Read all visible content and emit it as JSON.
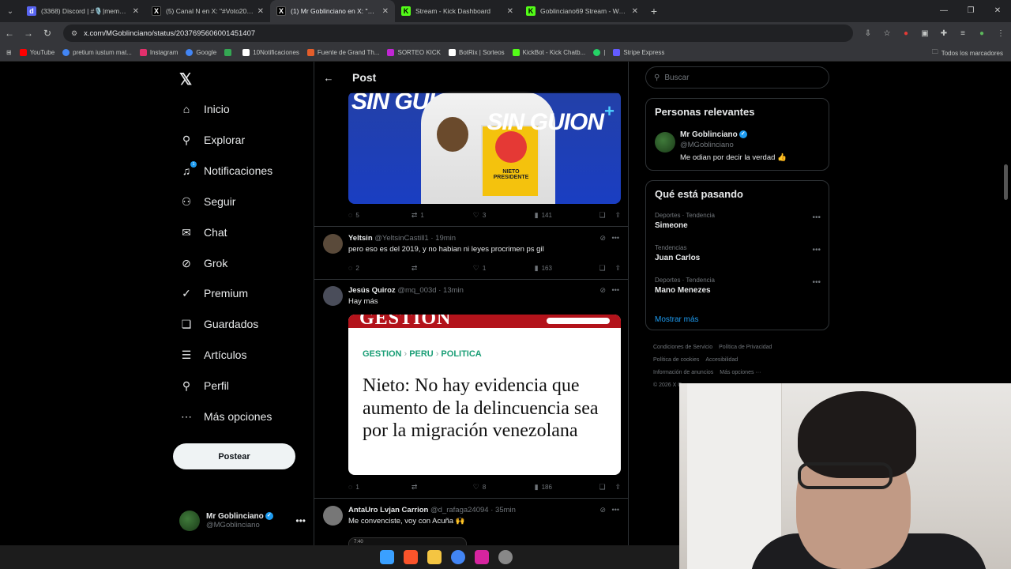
{
  "browser": {
    "tabs": [
      {
        "title": "(3368) Discord | #🎙️|memes |",
        "favicon_color": "#5865f2",
        "active": false
      },
      {
        "title": "(5) Canal N en X: \"#Voto2026 E",
        "favicon_color": "#000000",
        "active": false
      },
      {
        "title": "(1) Mr Goblinciano en X: \"Me o",
        "favicon_color": "#000000",
        "active": true
      },
      {
        "title": "Stream - Kick Dashboard",
        "favicon_color": "#53fc18",
        "active": false
      },
      {
        "title": "Goblinciano69 Stream - Watch",
        "favicon_color": "#53fc18",
        "active": false
      }
    ],
    "url": "x.com/MGoblinciano/status/2037695606001451407",
    "bookmarks": [
      {
        "label": "YouTube",
        "color": "#ff0000"
      },
      {
        "label": "pretium iustum mat...",
        "color": "#4285f4"
      },
      {
        "label": "Instagram",
        "color": "#e1306c"
      },
      {
        "label": "Google",
        "color": "#4285f4"
      },
      {
        "label": "",
        "color": "#34a853"
      },
      {
        "label": "10Notificaciones",
        "color": "#000000"
      },
      {
        "label": "Fuente de Grand Th...",
        "color": "#e35d2a"
      },
      {
        "label": "SORTEO KICK",
        "color": "#c026d3"
      },
      {
        "label": "BotRix | Sorteos",
        "color": "#ffffff"
      },
      {
        "label": "KickBot - Kick Chatb...",
        "color": "#53fc18"
      },
      {
        "label": "|",
        "color": "#25d366"
      },
      {
        "label": "Stripe Express",
        "color": "#635bff"
      }
    ],
    "all_bookmarks": "Todos los marcadores"
  },
  "nav": {
    "items": [
      {
        "label": "Inicio",
        "icon": "home-icon",
        "glyph": "⌂"
      },
      {
        "label": "Explorar",
        "icon": "search-icon",
        "glyph": "⌕"
      },
      {
        "label": "Notificaciones",
        "icon": "bell-icon",
        "glyph": "🔔"
      },
      {
        "label": "Seguir",
        "icon": "follow-icon",
        "glyph": "👤"
      },
      {
        "label": "Chat",
        "icon": "mail-icon",
        "glyph": "✉"
      },
      {
        "label": "Grok",
        "icon": "grok-icon",
        "glyph": "⊘"
      },
      {
        "label": "Premium",
        "icon": "premium-icon",
        "glyph": "✓"
      },
      {
        "label": "Guardados",
        "icon": "bookmark-icon",
        "glyph": "🔖"
      },
      {
        "label": "Artículos",
        "icon": "article-icon",
        "glyph": "☰"
      },
      {
        "label": "Perfil",
        "icon": "profile-icon",
        "glyph": "👤"
      },
      {
        "label": "Más opciones",
        "icon": "more-icon",
        "glyph": "⋯"
      }
    ],
    "post_button": "Postear",
    "account": {
      "name": "Mr Goblinciano",
      "handle": "@MGoblinciano"
    }
  },
  "main": {
    "title": "Post",
    "post_actions": {
      "replies": "5",
      "reposts": "1",
      "likes": "3",
      "views": "141"
    },
    "media1": {
      "left": "SIN GUI",
      "right": "SIN GUION",
      "book": "NIETO PRESIDENTE"
    },
    "replies": [
      {
        "name": "Yeltsin",
        "handle": "@YeltsinCastill1",
        "time": "19min",
        "text": "pero eso es del 2019, y no habian ni leyes procrimen ps gil",
        "actions": {
          "replies": "2",
          "reposts": "",
          "likes": "1",
          "views": "163"
        }
      },
      {
        "name": "Jesús Quiroz",
        "handle": "@mq_003d",
        "time": "13min",
        "text": "Hay más",
        "actions": {
          "replies": "1",
          "reposts": "",
          "likes": "8",
          "views": "186"
        }
      },
      {
        "name": "AntaUro Lvjan Carrion",
        "handle": "@d_rafaga24094",
        "time": "35min",
        "text": "Me convenciste, voy con Acuña 🙌"
      }
    ],
    "article": {
      "masthead": "GESTION",
      "breadcrumb": [
        "GESTION",
        "PERU",
        "POLITICA"
      ],
      "headline": "Nieto: No hay evidencia que aumento de la delincuencia sea por la migración venezolana"
    },
    "thumb_text": "7:40"
  },
  "right": {
    "search_placeholder": "Buscar",
    "relevant_title": "Personas relevantes",
    "relevant": {
      "name": "Mr Goblinciano",
      "handle": "@MGoblinciano",
      "bio": "Me odian por decir la verdad 👍"
    },
    "trending_title": "Qué está pasando",
    "trends": [
      {
        "context": "Deportes · Tendencia",
        "topic": "Simeone"
      },
      {
        "context": "Tendencias",
        "topic": "Juan Carlos"
      },
      {
        "context": "Deportes · Tendencia",
        "topic": "Mano Menezes"
      }
    ],
    "show_more": "Mostrar más",
    "footer": [
      "Condiciones de Servicio",
      "Política de Privacidad",
      "Política de cookies",
      "Accesibilidad",
      "Información de anuncios",
      "Más opciones ···",
      "© 2026 X Corp."
    ]
  }
}
